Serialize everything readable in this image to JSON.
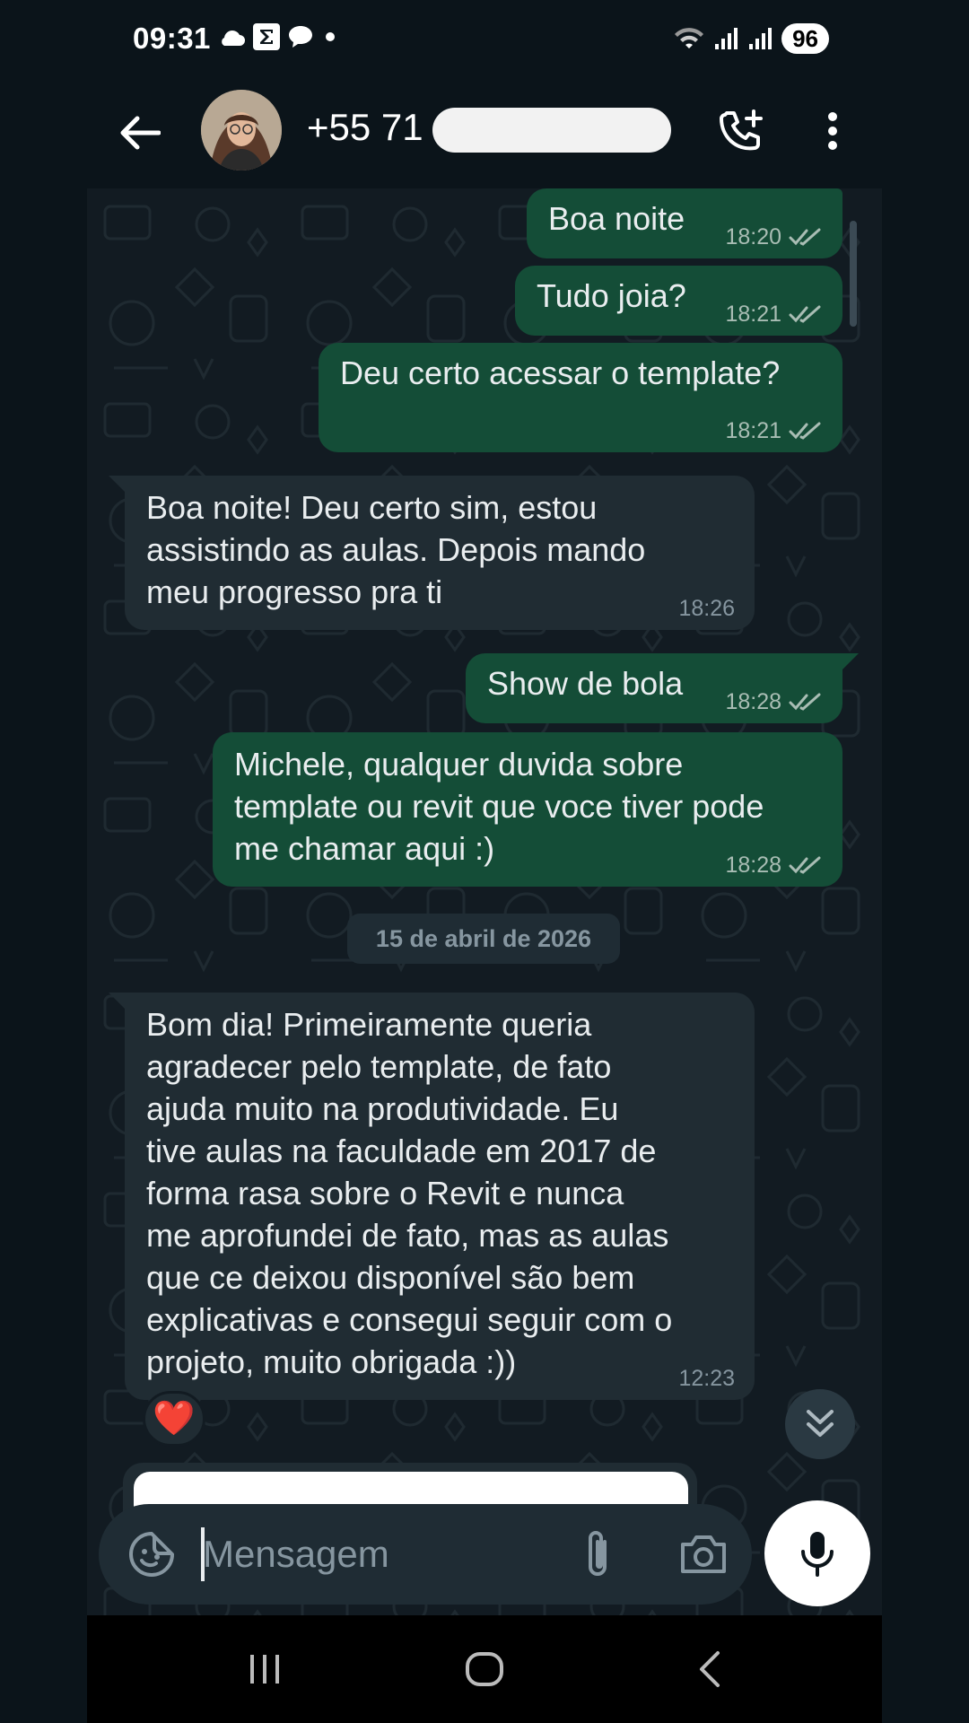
{
  "status_bar": {
    "time": "09:31",
    "battery": "96",
    "left_icons": [
      "cloud-icon",
      "sigma-app-icon",
      "chat-bubble-icon",
      "dot-icon"
    ],
    "right_icons": [
      "wifi-icon",
      "signal-icon",
      "signal-icon"
    ]
  },
  "header": {
    "contact_name": "+55 71",
    "icons": [
      "back-arrow-icon",
      "avatar",
      "add-call-icon",
      "more-vert-icon"
    ]
  },
  "messages": [
    {
      "direction": "out",
      "text": "Boa noite",
      "time": "18:20",
      "status": "read"
    },
    {
      "direction": "out",
      "text": "Tudo joia?",
      "time": "18:21",
      "status": "read"
    },
    {
      "direction": "out",
      "text": "Deu certo acessar o template?",
      "time": "18:21",
      "status": "read"
    },
    {
      "direction": "in",
      "text": "Boa noite! Deu certo sim, estou\nassistindo as aulas. Depois mando\nmeu progresso pra ti",
      "time": "18:26"
    },
    {
      "direction": "out",
      "text": "Show de bola",
      "time": "18:28",
      "status": "read"
    },
    {
      "direction": "out",
      "text": "Michele, qualquer duvida sobre\ntemplate ou revit que voce tiver pode\nme chamar aqui :)",
      "time": "18:28",
      "status": "read"
    },
    {
      "direction": "in",
      "text": "Bom dia! Primeiramente queria\nagradecer pelo template, de fato\najuda muito na produtividade. Eu\ntive aulas na faculdade em 2017 de\nforma rasa sobre o Revit e nunca\nme aprofundei de fato, mas as aulas\nque ce deixou disponível são bem\nexplicativas e consegui seguir com o\nprojeto, muito obrigada :))",
      "time": "12:23",
      "reaction": "❤️"
    }
  ],
  "date_separator": "15 de abril de 2026",
  "composer": {
    "placeholder": "Mensagem",
    "value": ""
  },
  "colors": {
    "background": "#0b141a",
    "chat_bg": "#121b22",
    "outgoing_bubble": "#144d37",
    "incoming_bubble": "#202c33",
    "read_ticks": "#a9bdb4"
  },
  "nav_bar": {
    "icons": [
      "recent-apps-icon",
      "home-icon",
      "back-nav-icon"
    ]
  }
}
